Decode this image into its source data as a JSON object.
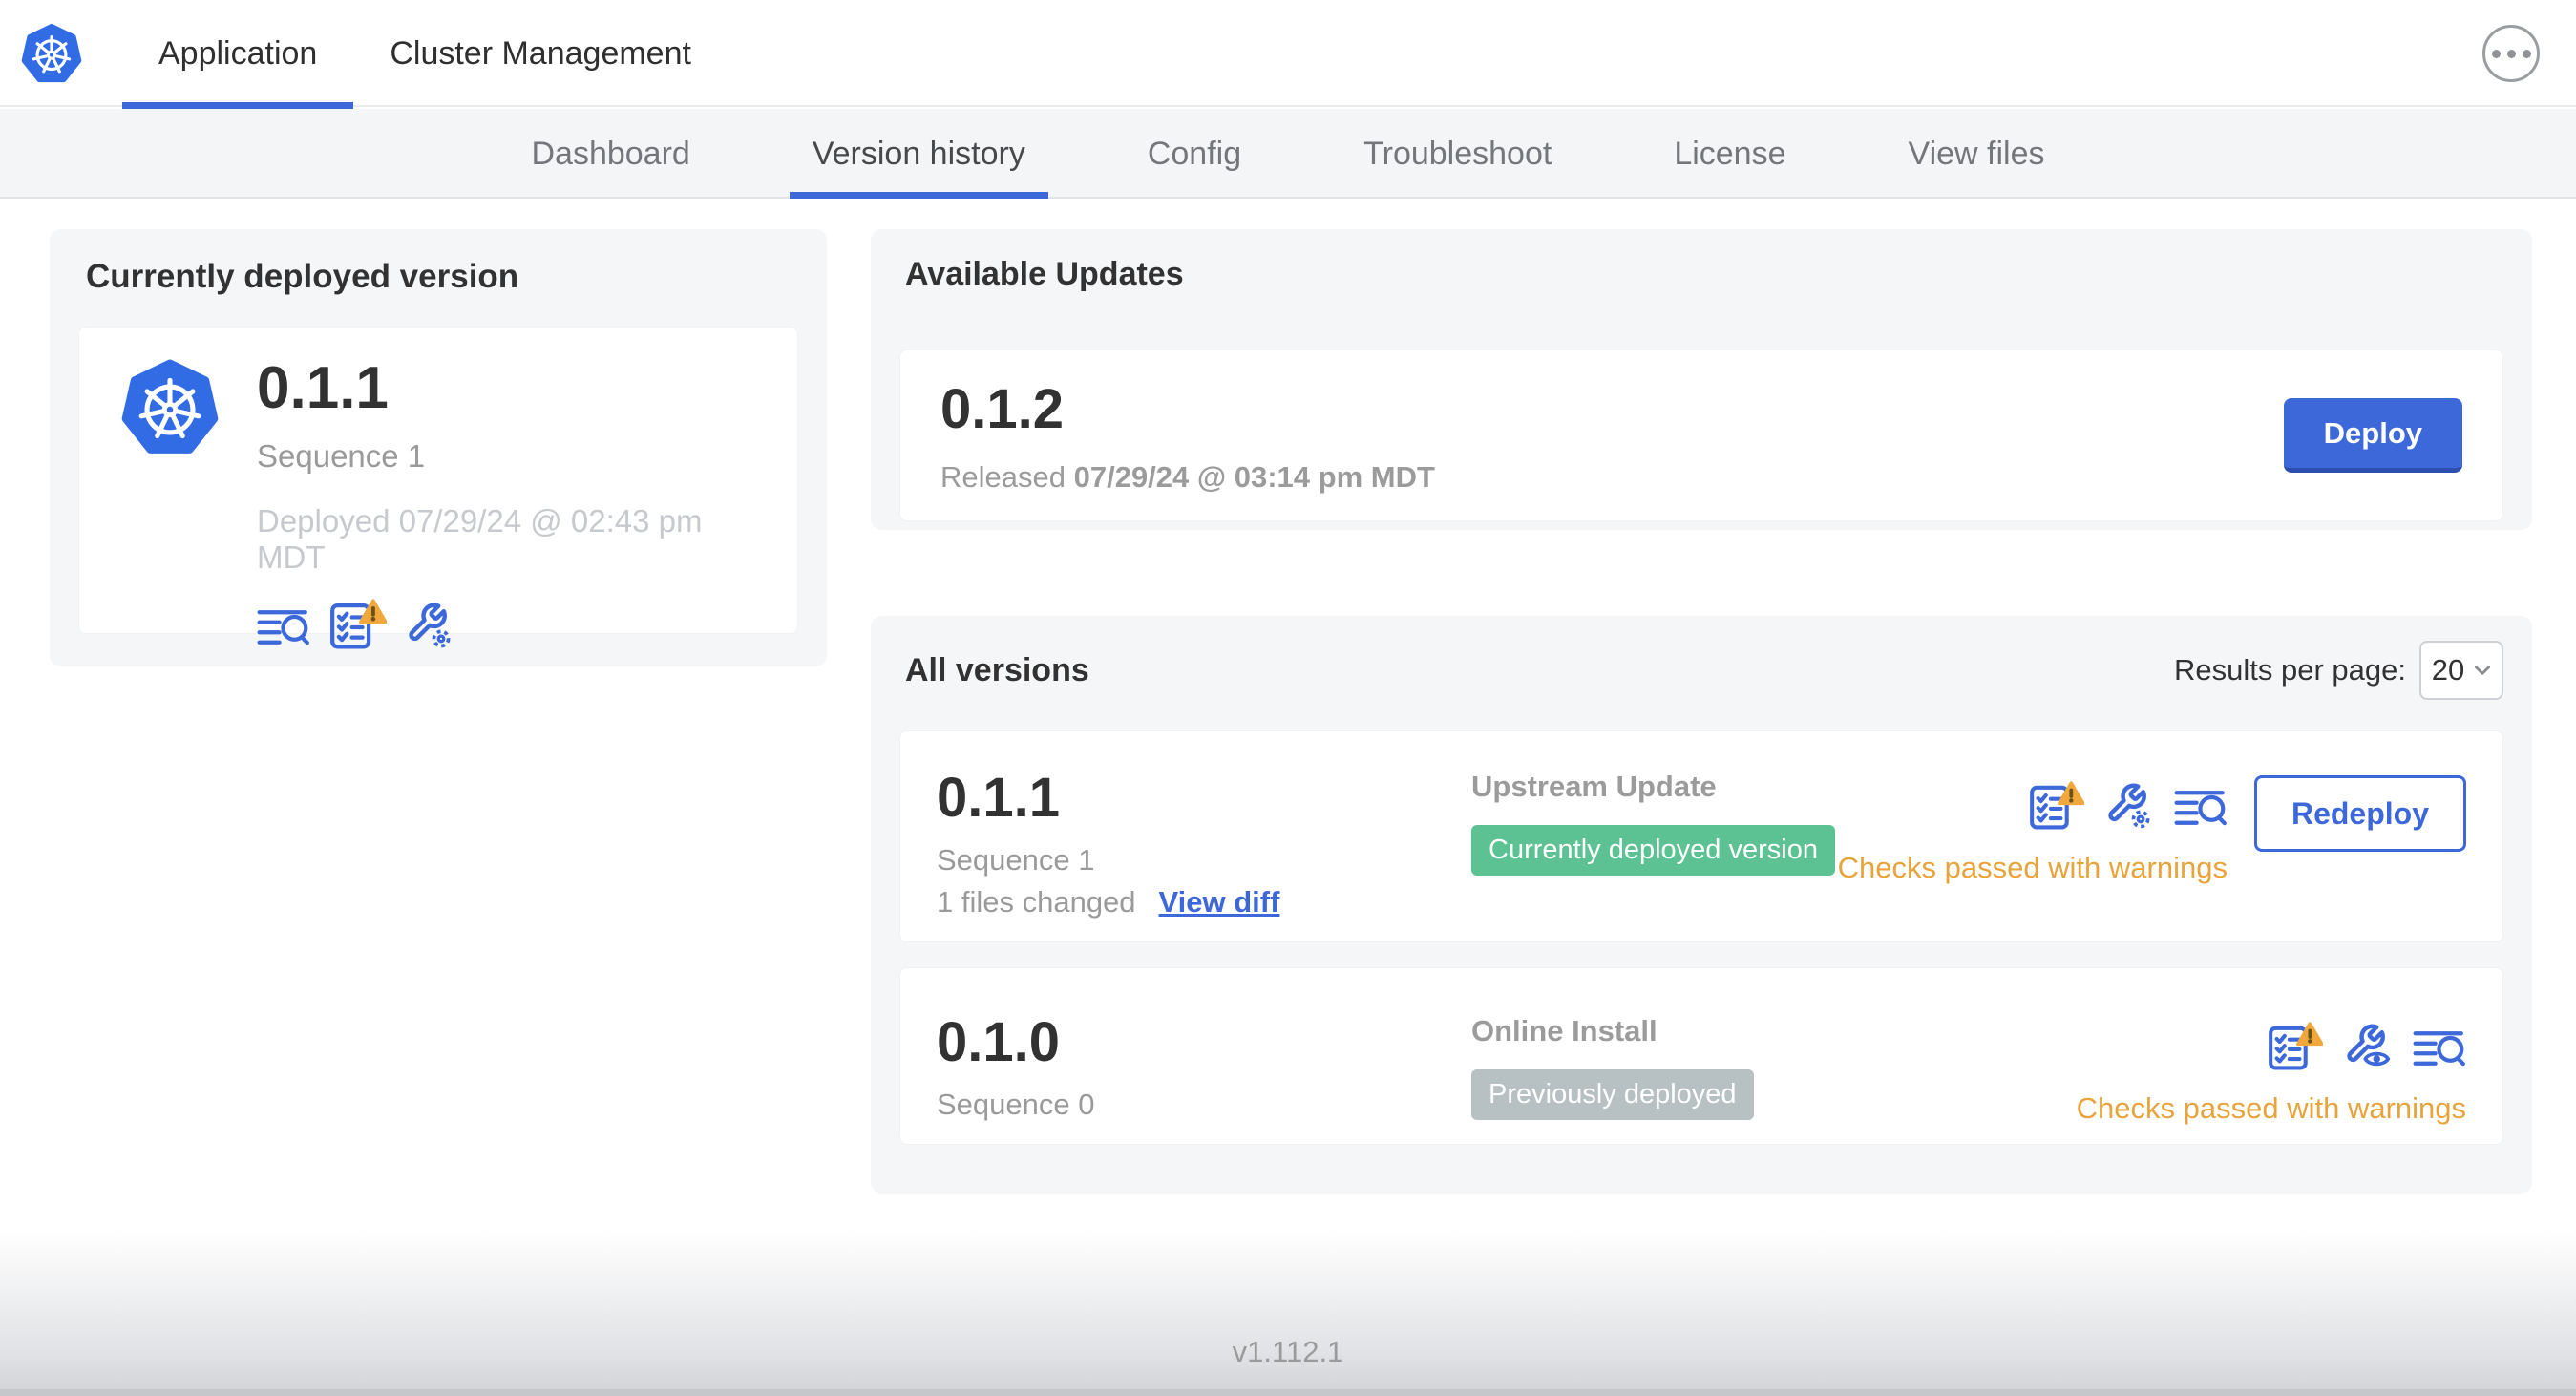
{
  "colors": {
    "accent": "#3d68da",
    "accent-dark": "#2f4fb0",
    "k8s-blue": "#326ce5",
    "badge-green": "#5cc293",
    "badge-gray": "#b7c0c3",
    "warn": "#f0a73c",
    "warn-text": "#e8a43c"
  },
  "header": {
    "tabs": [
      {
        "label": "Application"
      },
      {
        "label": "Cluster Management"
      }
    ]
  },
  "subnav": {
    "tabs": [
      {
        "label": "Dashboard"
      },
      {
        "label": "Version history"
      },
      {
        "label": "Config"
      },
      {
        "label": "Troubleshoot"
      },
      {
        "label": "License"
      },
      {
        "label": "View files"
      }
    ]
  },
  "current": {
    "title": "Currently deployed version",
    "version": "0.1.1",
    "sequence": "Sequence 1",
    "deployed": "Deployed 07/29/24 @ 02:43 pm MDT"
  },
  "updates": {
    "title": "Available Updates",
    "version": "0.1.2",
    "released_prefix": "Released",
    "released_date": "07/29/24 @ 03:14 pm MDT",
    "deploy_label": "Deploy"
  },
  "all_versions": {
    "title": "All versions",
    "results_label": "Results per page:",
    "results_value": "20",
    "rows": [
      {
        "version": "0.1.1",
        "sequence": "Sequence 1",
        "files_changed": "1 files changed",
        "view_diff": "View diff",
        "source": "Upstream Update",
        "badge": "Currently deployed version",
        "checks": "Checks passed with warnings",
        "action": "Redeploy"
      },
      {
        "version": "0.1.0",
        "sequence": "Sequence 0",
        "source": "Online Install",
        "badge": "Previously deployed",
        "checks": "Checks passed with warnings"
      }
    ]
  },
  "footer": {
    "app_version": "v1.112.1"
  }
}
